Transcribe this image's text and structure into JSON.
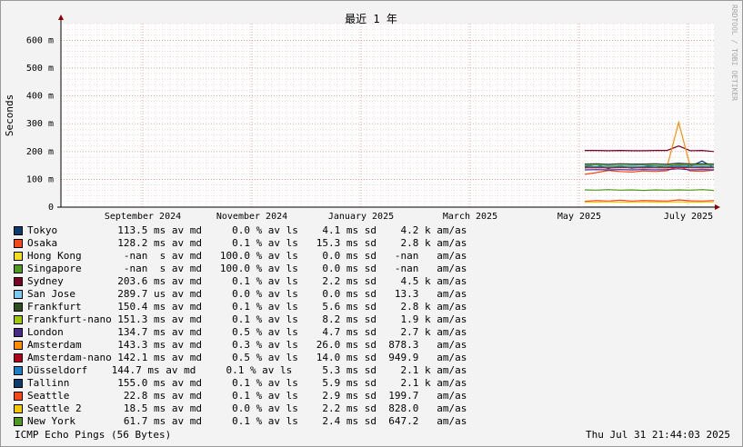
{
  "chart_data": {
    "type": "line",
    "title": "最近 1 年",
    "ylabel": "Seconds",
    "watermark": "RRDTOOL / TOBI OETIKER",
    "y_unit_suffix": "m",
    "ylim": [
      0,
      660
    ],
    "yticks": [
      0,
      100,
      200,
      300,
      400,
      500,
      600
    ],
    "x_tick_labels": [
      "September 2024",
      "November 2024",
      "January 2025",
      "March 2025",
      "May 2025",
      "July 2025"
    ],
    "grid": true,
    "series": [
      {
        "name": "Tokyo",
        "color": "#0b3e70",
        "values": [
          146,
          152,
          139,
          148,
          140,
          145,
          150,
          142,
          158,
          147,
          166,
          141
        ]
      },
      {
        "name": "Osaka",
        "color": "#fa4716",
        "values": [
          118,
          124,
          132,
          128,
          126,
          130,
          128,
          131,
          147,
          130,
          129,
          133
        ]
      },
      {
        "name": "Hong Kong",
        "color": "#f5dd1b",
        "values": [
          null,
          null,
          null,
          null,
          null,
          null,
          null,
          null,
          null,
          null,
          null,
          null
        ]
      },
      {
        "name": "Singapore",
        "color": "#4e9a1e",
        "values": [
          null,
          null,
          null,
          null,
          null,
          null,
          null,
          null,
          null,
          null,
          null,
          null
        ]
      },
      {
        "name": "Sydney",
        "color": "#7a0025",
        "values": [
          204,
          204,
          203,
          204,
          203,
          203,
          204,
          204,
          220,
          203,
          204,
          200
        ]
      },
      {
        "name": "San Jose",
        "color": "#79c9f0",
        "values": [
          0.2897,
          0.2897,
          0.2897,
          0.2897,
          0.2897,
          0.2897,
          0.2897,
          0.2897,
          0.2897,
          0.2897,
          0.2897,
          0.2897
        ]
      },
      {
        "name": "Frankfurt",
        "color": "#2f4f1e",
        "values": [
          150,
          151,
          149,
          150,
          150,
          151,
          150,
          149,
          152,
          150,
          151,
          150
        ]
      },
      {
        "name": "Frankfurt-nano",
        "color": "#a0c60e",
        "values": [
          151,
          152,
          150,
          151,
          151,
          152,
          151,
          150,
          155,
          152,
          153,
          151
        ]
      },
      {
        "name": "London",
        "color": "#4a2a87",
        "values": [
          134,
          135,
          134,
          135,
          134,
          135,
          134,
          135,
          138,
          134,
          135,
          134
        ]
      },
      {
        "name": "Amsterdam",
        "color": "#ff8c00",
        "values": [
          142,
          143,
          142,
          144,
          143,
          143,
          142,
          144,
          305,
          143,
          144,
          142
        ]
      },
      {
        "name": "Amsterdam-nano",
        "color": "#b0001a",
        "values": [
          141,
          142,
          141,
          142,
          142,
          141,
          142,
          141,
          143,
          142,
          141,
          142
        ]
      },
      {
        "name": "Düsseldorf",
        "color": "#1b7fc8",
        "values": [
          144,
          145,
          144,
          145,
          144,
          145,
          144,
          145,
          147,
          144,
          145,
          144
        ]
      },
      {
        "name": "Tallinn",
        "color": "#0b3e70",
        "values": [
          155,
          156,
          154,
          156,
          155,
          155,
          156,
          154,
          158,
          155,
          156,
          155
        ]
      },
      {
        "name": "Seattle",
        "color": "#fa4716",
        "values": [
          21,
          24,
          22,
          25,
          22,
          24,
          23,
          22,
          26,
          23,
          22,
          24
        ]
      },
      {
        "name": "Seattle 2",
        "color": "#f5c700",
        "values": [
          18,
          18,
          19,
          18,
          18,
          19,
          18,
          18,
          19,
          18,
          18,
          19
        ]
      },
      {
        "name": "New York",
        "color": "#4e9a1e",
        "values": [
          62,
          61,
          63,
          61,
          62,
          60,
          62,
          61,
          62,
          61,
          63,
          60
        ]
      }
    ]
  },
  "legend": [
    {
      "name": "Tokyo",
      "color": "#0b3e70",
      "stats": "  113.5 ms av md     0.0 % av ls    4.1 ms sd    4.2 k am/as"
    },
    {
      "name": "Osaka",
      "color": "#fa4716",
      "stats": "  128.2 ms av md     0.1 % av ls   15.3 ms sd    2.8 k am/as"
    },
    {
      "name": "Hong Kong",
      "color": "#f5dd1b",
      "stats": "   -nan  s av md   100.0 % av ls    0.0 ms sd   -nan   am/as"
    },
    {
      "name": "Singapore",
      "color": "#4e9a1e",
      "stats": "   -nan  s av md   100.0 % av ls    0.0 ms sd   -nan   am/as"
    },
    {
      "name": "Sydney",
      "color": "#7a0025",
      "stats": "  203.6 ms av md     0.1 % av ls    2.2 ms sd    4.5 k am/as"
    },
    {
      "name": "San Jose",
      "color": "#79c9f0",
      "stats": "  289.7 us av md     0.0 % av ls    0.0 ms sd   13.3   am/as"
    },
    {
      "name": "Frankfurt",
      "color": "#2f4f1e",
      "stats": "  150.4 ms av md     0.1 % av ls    5.6 ms sd    2.8 k am/as"
    },
    {
      "name": "Frankfurt-nano",
      "color": "#a0c60e",
      "stats": "  151.3 ms av md     0.1 % av ls    8.2 ms sd    1.9 k am/as"
    },
    {
      "name": "London",
      "color": "#4a2a87",
      "stats": "  134.7 ms av md     0.5 % av ls    4.7 ms sd    2.7 k am/as"
    },
    {
      "name": "Amsterdam",
      "color": "#ff8c00",
      "stats": "  143.3 ms av md     0.3 % av ls   26.0 ms sd  878.3   am/as"
    },
    {
      "name": "Amsterdam-nano",
      "color": "#b0001a",
      "stats": "  142.1 ms av md     0.5 % av ls   14.0 ms sd  949.9   am/as"
    },
    {
      "name": "Düsseldorf",
      "color": "#1b7fc8",
      "stats": " 144.7 ms av md     0.1 % av ls     5.3 ms sd    2.1 k am/as"
    },
    {
      "name": "Tallinn",
      "color": "#0b3e70",
      "stats": "  155.0 ms av md     0.1 % av ls    5.9 ms sd    2.1 k am/as"
    },
    {
      "name": "Seattle",
      "color": "#fa4716",
      "stats": "   22.8 ms av md     0.1 % av ls    2.9 ms sd  199.7   am/as"
    },
    {
      "name": "Seattle 2",
      "color": "#f5c700",
      "stats": "   18.5 ms av md     0.0 % av ls    2.2 ms sd  828.0   am/as"
    },
    {
      "name": "New York",
      "color": "#4e9a1e",
      "stats": "   61.7 ms av md     0.1 % av ls    2.4 ms sd  647.2   am/as"
    }
  ],
  "footer": {
    "left": "ICMP Echo Pings (56 Bytes)",
    "right": "Thu Jul 31 21:44:03 2025"
  }
}
